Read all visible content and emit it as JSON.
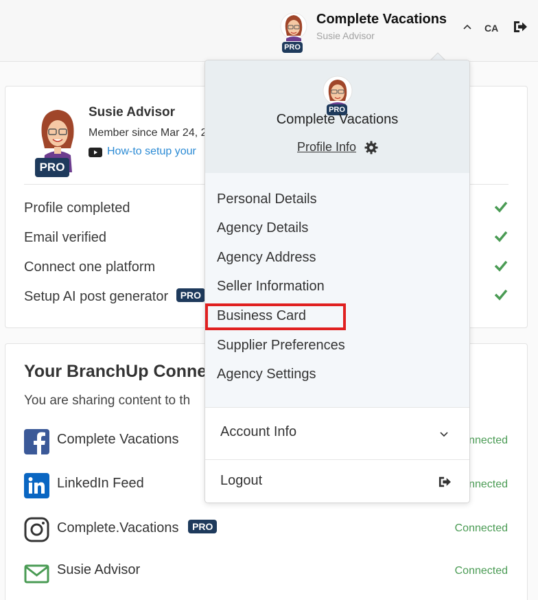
{
  "header": {
    "company": "Complete Vacations",
    "user": "Susie Advisor",
    "pro_badge": "PRO",
    "language": "CA"
  },
  "profile": {
    "name": "Susie Advisor",
    "member_since": "Member since Mar 24, 2",
    "howto_link": "How-to setup your",
    "pro_badge": "PRO"
  },
  "checklist": [
    {
      "label": "Profile completed",
      "pro": ""
    },
    {
      "label": "Email verified",
      "pro": ""
    },
    {
      "label": "Connect one platform",
      "pro": ""
    },
    {
      "label": "Setup AI post generator",
      "pro": "PRO"
    }
  ],
  "connections": {
    "title": "Your BranchUp Conne",
    "subtitle": "You are sharing content to th",
    "items": [
      {
        "icon": "facebook-icon",
        "name": "Complete Vacations",
        "pro": "",
        "status": "nnected"
      },
      {
        "icon": "linkedin-icon",
        "name": "LinkedIn Feed",
        "pro": "",
        "status": "nnected"
      },
      {
        "icon": "instagram-icon",
        "name": "Complete.Vacations",
        "pro": "PRO",
        "status": "Connected"
      },
      {
        "icon": "email-icon",
        "name": "Susie Advisor",
        "pro": "",
        "status": "Connected"
      }
    ]
  },
  "dropdown": {
    "title": "Complete Vacations",
    "pro_badge": "PRO",
    "profile_info": "Profile Info",
    "items": [
      "Personal Details",
      "Agency Details",
      "Agency Address",
      "Seller Information",
      "Business Card",
      "Supplier Preferences",
      "Agency Settings"
    ],
    "highlighted_item": "Business Card",
    "account_info": "Account Info",
    "logout": "Logout"
  },
  "colors": {
    "pro_badge": "#1e3a5c",
    "check_green": "#4a9b54",
    "link_blue": "#2a8ad4",
    "highlight_red": "#e02020",
    "facebook": "#3b5998",
    "linkedin": "#0a66c2",
    "email": "#4a9b54"
  }
}
